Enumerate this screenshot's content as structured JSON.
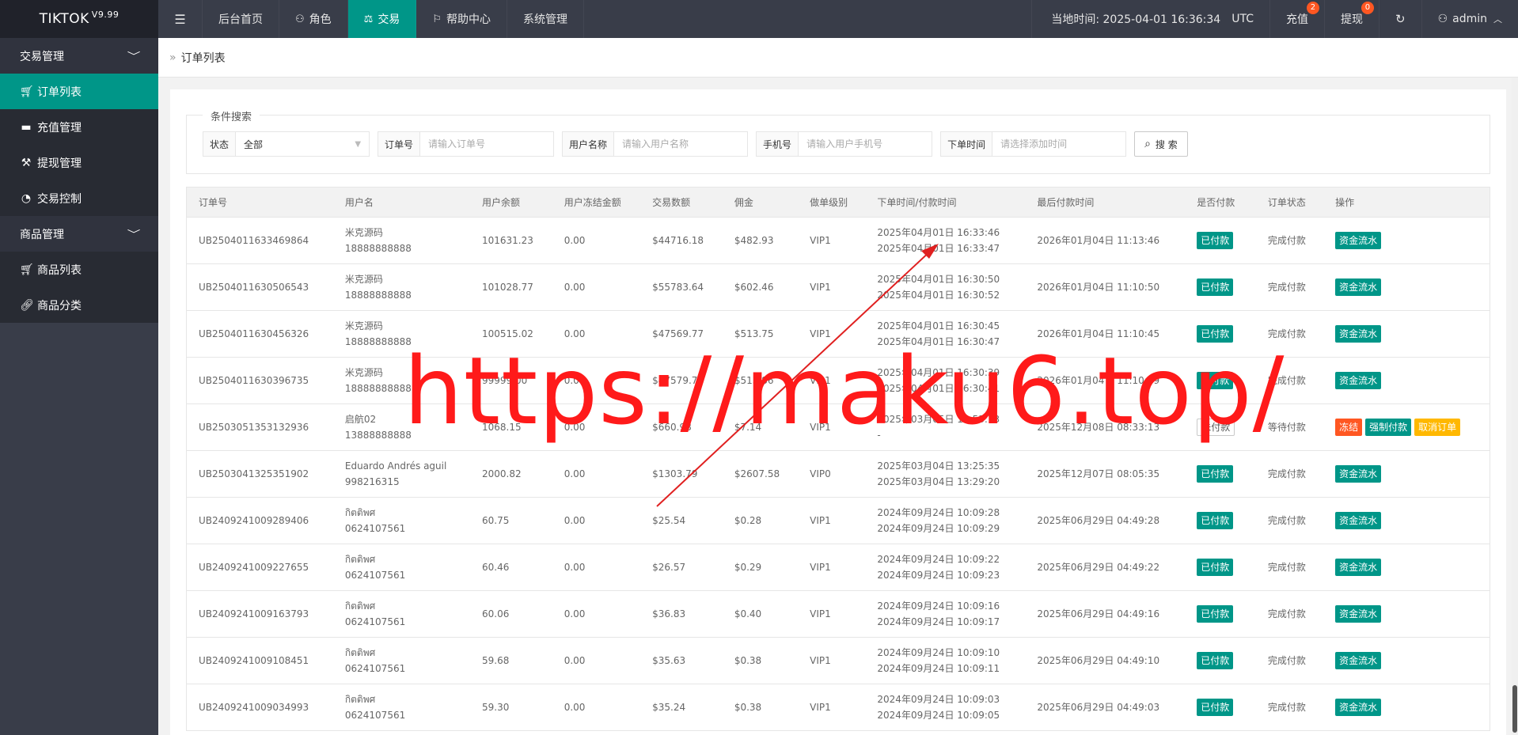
{
  "header": {
    "logo": "TIKTOK",
    "version": "V9.99",
    "nav": [
      {
        "label": "后台首页",
        "icon": ""
      },
      {
        "label": "角色",
        "icon": "user-icon"
      },
      {
        "label": "交易",
        "icon": "scale-icon"
      },
      {
        "label": "帮助中心",
        "icon": "flag-icon"
      },
      {
        "label": "系统管理",
        "icon": ""
      }
    ],
    "time_label": "当地时间: 2025-04-01 16:36:34",
    "timezone": "UTC",
    "recharge": {
      "label": "充值",
      "count": "2"
    },
    "withdraw": {
      "label": "提现",
      "count": "0"
    },
    "user": "admin"
  },
  "sidebar": {
    "groups": [
      {
        "label": "交易管理",
        "items": [
          "订单列表",
          "充值管理",
          "提现管理",
          "交易控制"
        ]
      },
      {
        "label": "商品管理",
        "items": [
          "商品列表",
          "商品分类"
        ]
      }
    ]
  },
  "breadcrumb": "订单列表",
  "search": {
    "legend": "条件搜索",
    "status_label": "状态",
    "status_value": "全部",
    "order_label": "订单号",
    "order_placeholder": "请输入订单号",
    "user_label": "用户名称",
    "user_placeholder": "请输入用户名称",
    "phone_label": "手机号",
    "phone_placeholder": "请输入用户手机号",
    "time_label": "下单时间",
    "time_placeholder": "请选择添加时间",
    "button": "搜 索"
  },
  "table": {
    "columns": [
      "订单号",
      "用户名",
      "用户余额",
      "用户冻结金额",
      "交易数额",
      "佣金",
      "做单级别",
      "下单时间/付款时间",
      "最后付款时间",
      "是否付款",
      "订单状态",
      "操作"
    ],
    "rows": [
      {
        "id": "UB2504011633469864",
        "name": "米克源码",
        "phone": "18888888888",
        "balance": "101631.23",
        "frozen": "0.00",
        "amount": "$44716.18",
        "commission": "$482.93",
        "level": "VIP1",
        "t1": "2025年04月01日 16:33:46",
        "t2": "2025年04月01日 16:33:47",
        "last": "2026年01月04日 11:13:46",
        "paid": "已付款",
        "paid_style": "green",
        "status": "完成付款",
        "actions": [
          {
            "label": "资金流水",
            "style": "green"
          }
        ]
      },
      {
        "id": "UB2504011630506543",
        "name": "米克源码",
        "phone": "18888888888",
        "balance": "101028.77",
        "frozen": "0.00",
        "amount": "$55783.64",
        "commission": "$602.46",
        "level": "VIP1",
        "t1": "2025年04月01日 16:30:50",
        "t2": "2025年04月01日 16:30:52",
        "last": "2026年01月04日 11:10:50",
        "paid": "已付款",
        "paid_style": "green",
        "status": "完成付款",
        "actions": [
          {
            "label": "资金流水",
            "style": "green"
          }
        ]
      },
      {
        "id": "UB2504011630456326",
        "name": "米克源码",
        "phone": "18888888888",
        "balance": "100515.02",
        "frozen": "0.00",
        "amount": "$47569.77",
        "commission": "$513.75",
        "level": "VIP1",
        "t1": "2025年04月01日 16:30:45",
        "t2": "2025年04月01日 16:30:47",
        "last": "2026年01月04日 11:10:45",
        "paid": "已付款",
        "paid_style": "green",
        "status": "完成付款",
        "actions": [
          {
            "label": "资金流水",
            "style": "green"
          }
        ]
      },
      {
        "id": "UB2504011630396735",
        "name": "米克源码",
        "phone": "18888888888",
        "balance": "99999.00",
        "frozen": "0.00",
        "amount": "$47579.70",
        "commission": "$513.86",
        "level": "VIP1",
        "t1": "2025年04月01日 16:30:39",
        "t2": "2025年04月01日 16:30:41",
        "last": "2026年01月04日 11:10:39",
        "paid": "已付款",
        "paid_style": "green",
        "status": "完成付款",
        "actions": [
          {
            "label": "资金流水",
            "style": "green"
          }
        ]
      },
      {
        "id": "UB2503051353132936",
        "name": "启航02",
        "phone": "13888888888",
        "balance": "1068.15",
        "frozen": "0.00",
        "amount": "$660.98",
        "commission": "$7.14",
        "level": "VIP1",
        "t1": "2025年03月05日 13:53:13",
        "t2": "-",
        "last": "2025年12月08日 08:33:13",
        "paid": "未付款",
        "paid_style": "outline",
        "status": "等待付款",
        "actions": [
          {
            "label": "冻结",
            "style": "red"
          },
          {
            "label": "强制付款",
            "style": "green"
          },
          {
            "label": "取消订单",
            "style": "yellow"
          }
        ]
      },
      {
        "id": "UB2503041325351902",
        "name": "Eduardo Andrés aguil",
        "phone": "998216315",
        "balance": "2000.82",
        "frozen": "0.00",
        "amount": "$1303.79",
        "commission": "$2607.58",
        "level": "VIP0",
        "t1": "2025年03月04日 13:25:35",
        "t2": "2025年03月04日 13:29:20",
        "last": "2025年12月07日 08:05:35",
        "paid": "已付款",
        "paid_style": "green",
        "status": "完成付款",
        "actions": [
          {
            "label": "资金流水",
            "style": "green"
          }
        ]
      },
      {
        "id": "UB2409241009289406",
        "name": "กิตติพศ",
        "phone": "0624107561",
        "balance": "60.75",
        "frozen": "0.00",
        "amount": "$25.54",
        "commission": "$0.28",
        "level": "VIP1",
        "t1": "2024年09月24日 10:09:28",
        "t2": "2024年09月24日 10:09:29",
        "last": "2025年06月29日 04:49:28",
        "paid": "已付款",
        "paid_style": "green",
        "status": "完成付款",
        "actions": [
          {
            "label": "资金流水",
            "style": "green"
          }
        ]
      },
      {
        "id": "UB2409241009227655",
        "name": "กิตติพศ",
        "phone": "0624107561",
        "balance": "60.46",
        "frozen": "0.00",
        "amount": "$26.57",
        "commission": "$0.29",
        "level": "VIP1",
        "t1": "2024年09月24日 10:09:22",
        "t2": "2024年09月24日 10:09:23",
        "last": "2025年06月29日 04:49:22",
        "paid": "已付款",
        "paid_style": "green",
        "status": "完成付款",
        "actions": [
          {
            "label": "资金流水",
            "style": "green"
          }
        ]
      },
      {
        "id": "UB2409241009163793",
        "name": "กิตติพศ",
        "phone": "0624107561",
        "balance": "60.06",
        "frozen": "0.00",
        "amount": "$36.83",
        "commission": "$0.40",
        "level": "VIP1",
        "t1": "2024年09月24日 10:09:16",
        "t2": "2024年09月24日 10:09:17",
        "last": "2025年06月29日 04:49:16",
        "paid": "已付款",
        "paid_style": "green",
        "status": "完成付款",
        "actions": [
          {
            "label": "资金流水",
            "style": "green"
          }
        ]
      },
      {
        "id": "UB2409241009108451",
        "name": "กิตติพศ",
        "phone": "0624107561",
        "balance": "59.68",
        "frozen": "0.00",
        "amount": "$35.63",
        "commission": "$0.38",
        "level": "VIP1",
        "t1": "2024年09月24日 10:09:10",
        "t2": "2024年09月24日 10:09:11",
        "last": "2025年06月29日 04:49:10",
        "paid": "已付款",
        "paid_style": "green",
        "status": "完成付款",
        "actions": [
          {
            "label": "资金流水",
            "style": "green"
          }
        ]
      },
      {
        "id": "UB2409241009034993",
        "name": "กิตติพศ",
        "phone": "0624107561",
        "balance": "59.30",
        "frozen": "0.00",
        "amount": "$35.24",
        "commission": "$0.38",
        "level": "VIP1",
        "t1": "2024年09月24日 10:09:03",
        "t2": "2024年09月24日 10:09:05",
        "last": "2025年06月29日 04:49:03",
        "paid": "已付款",
        "paid_style": "green",
        "status": "完成付款",
        "actions": [
          {
            "label": "资金流水",
            "style": "green"
          }
        ]
      }
    ]
  },
  "watermark": "https://maku6.top/",
  "colors": {
    "accent": "#009688",
    "danger": "#ff5722",
    "warn": "#ffb800",
    "watermark": "#ff1a1a"
  }
}
